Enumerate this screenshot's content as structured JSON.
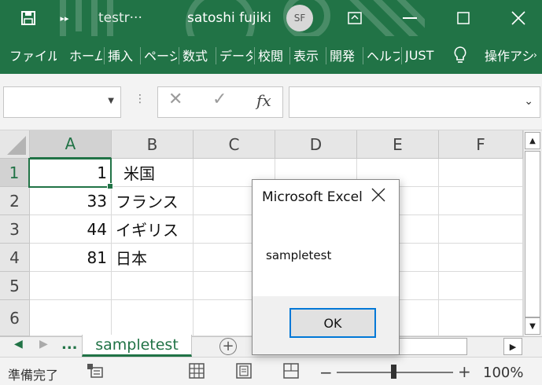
{
  "titlebar": {
    "doc_title": "testr···",
    "user_name": "satoshi fujiki",
    "avatar_initials": "SF"
  },
  "ribbon": {
    "tabs": [
      "ファイル",
      "ホーム",
      "挿入",
      "ページ",
      "数式",
      "データ",
      "校閲",
      "表示",
      "開発",
      "ヘルプ",
      "JUST",
      "操作アシ"
    ]
  },
  "formula_bar": {
    "name_box": "",
    "formula": "",
    "fx_label": "fx"
  },
  "sheet": {
    "columns": [
      "A",
      "B",
      "C",
      "D",
      "E",
      "F"
    ],
    "rows": [
      "1",
      "2",
      "3",
      "4",
      "5",
      "6"
    ],
    "active_cell": "A1",
    "data": [
      [
        "1",
        "米国",
        "",
        "",
        "",
        ""
      ],
      [
        "33",
        "フランス",
        "",
        "",
        "",
        ""
      ],
      [
        "44",
        "イギリス",
        "",
        "",
        "",
        ""
      ],
      [
        "81",
        "日本",
        "",
        "",
        "",
        ""
      ],
      [
        "",
        "",
        "",
        "",
        "",
        ""
      ],
      [
        "",
        "",
        "",
        "",
        "",
        ""
      ]
    ]
  },
  "sheet_tabs": {
    "more_label": "...",
    "active_tab": "sampletest",
    "add_label": "+"
  },
  "statusbar": {
    "status": "準備完了",
    "zoom": "100%",
    "zoom_minus": "−",
    "zoom_plus": "+"
  },
  "dialog": {
    "title": "Microsoft Excel",
    "message": "sampletest",
    "ok_label": "OK"
  },
  "colors": {
    "excel_green": "#217346",
    "dialog_button_border": "#0078d7"
  }
}
